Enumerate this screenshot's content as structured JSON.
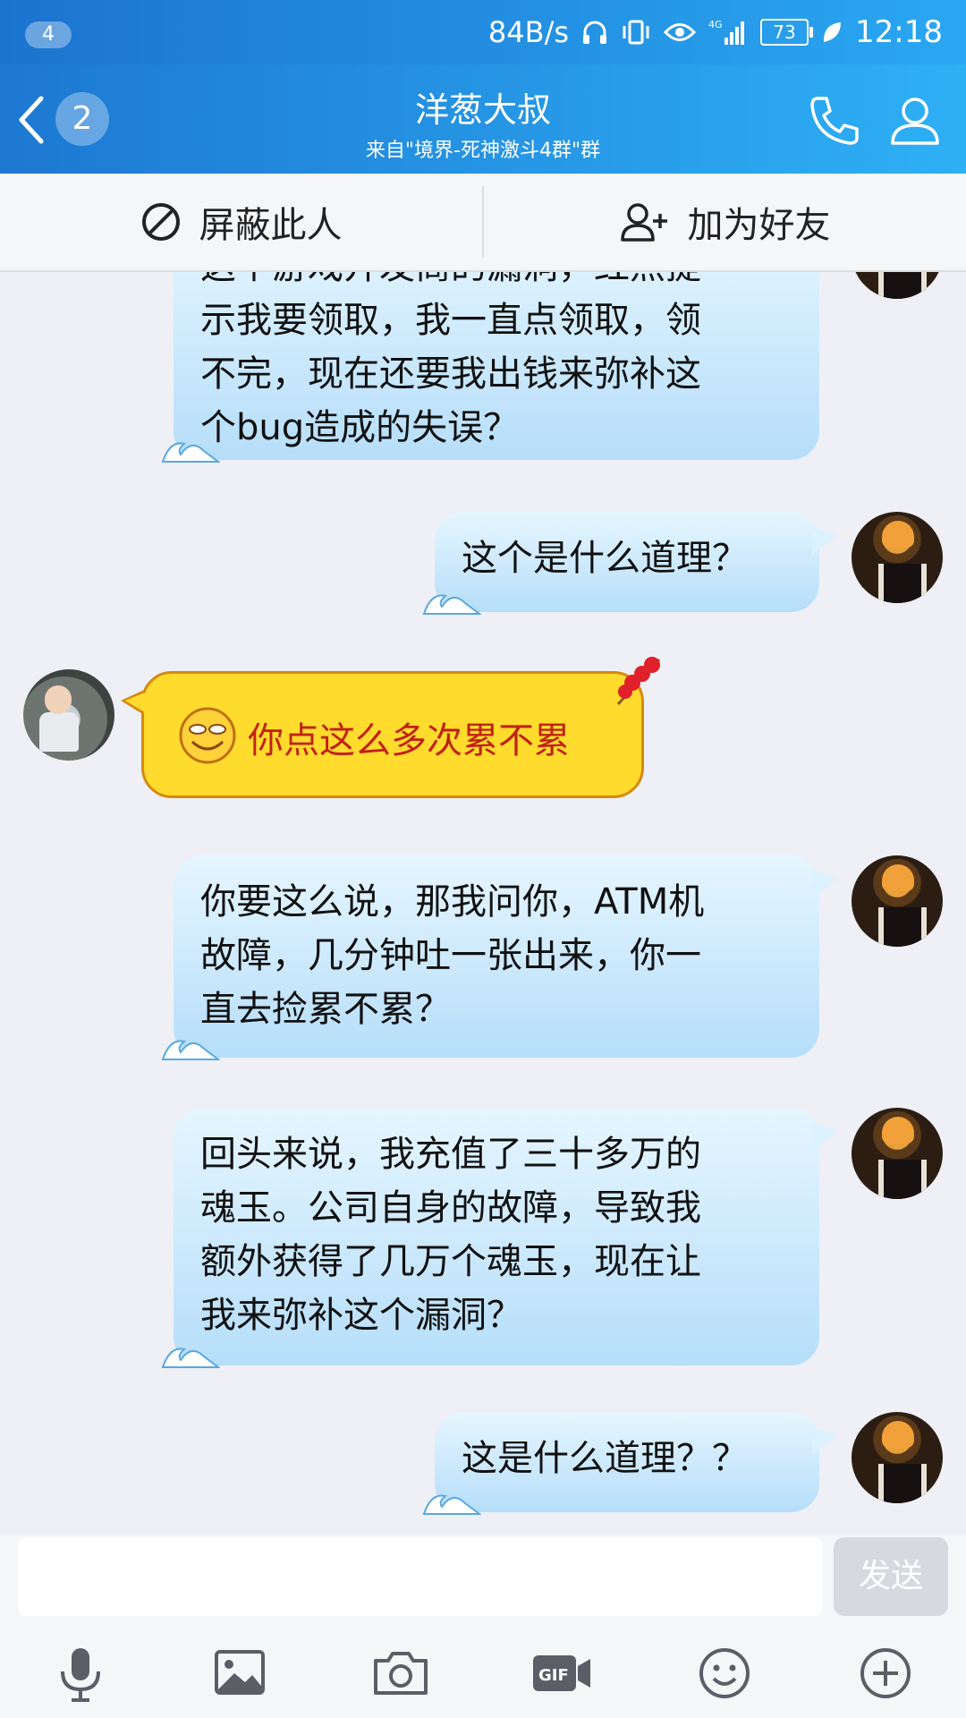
{
  "status_bar": {
    "notification_count": "4",
    "network_speed": "84B/s",
    "network_type": "4G",
    "battery": "73",
    "time": "12:18"
  },
  "header": {
    "unread_count": "2",
    "title": "洋葱大叔",
    "subtitle": "来自\"境界-死神激斗4群\"群"
  },
  "actions": {
    "block_label": "屏蔽此人",
    "add_friend_label": "加为好友"
  },
  "messages": [
    {
      "sender": "me",
      "lines": [
        "这个游戏开发商的漏洞，红点提",
        "示我要领取，我一直点领取，领",
        "不完，现在还要我出钱来弥补这",
        "个bug造成的失误？"
      ]
    },
    {
      "sender": "me",
      "lines": [
        "这个是什么道理？"
      ]
    },
    {
      "sender": "other",
      "lines": [
        "你点这么多次累不累"
      ]
    },
    {
      "sender": "me",
      "lines": [
        "你要这么说，那我问你，ATM机",
        "故障，几分钟吐一张出来，你一",
        "直去捡累不累？"
      ]
    },
    {
      "sender": "me",
      "lines": [
        "回头来说，我充值了三十多万的",
        "魂玉。公司自身的故障，导致我",
        "额外获得了几万个魂玉，现在让",
        "我来弥补这个漏洞？"
      ]
    },
    {
      "sender": "me",
      "lines": [
        "这是什么道理？？"
      ]
    }
  ],
  "input": {
    "placeholder": "",
    "value": "",
    "send_label": "发送"
  },
  "toolbar": {
    "icons": [
      "microphone-icon",
      "image-icon",
      "camera-icon",
      "gif-icon",
      "emoji-icon",
      "plus-icon"
    ]
  },
  "colors": {
    "header_start": "#1d78d2",
    "header_end": "#2eb0f5",
    "bubble_blue": "#b6defa",
    "bubble_yellow": "#ffdb2e",
    "yellow_text": "#c0220f",
    "background": "#eef0f5"
  }
}
